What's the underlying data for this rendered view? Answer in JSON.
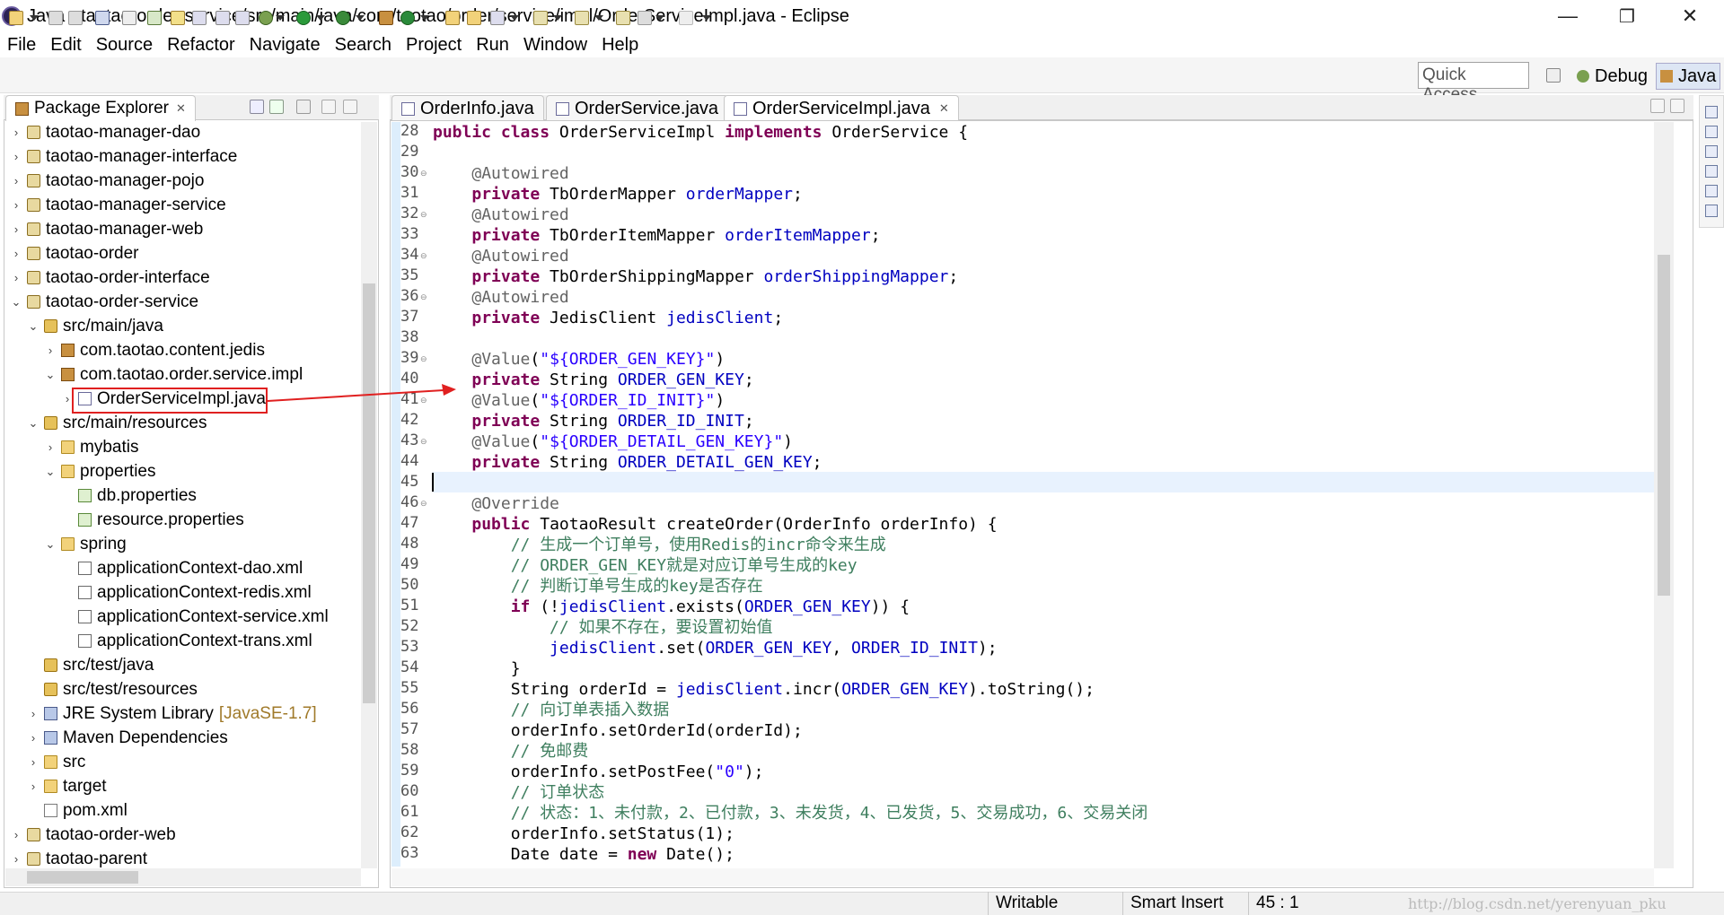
{
  "window": {
    "title": "Java - taotao-order-service/src/main/java/com/taotao/order/service/impl/OrderServiceImpl.java - Eclipse",
    "minimize": "—",
    "maximize": "❐",
    "close": "✕"
  },
  "menu": [
    "File",
    "Edit",
    "Source",
    "Refactor",
    "Navigate",
    "Search",
    "Project",
    "Run",
    "Window",
    "Help"
  ],
  "toolbar": {
    "quick_access": "Quick Access",
    "debug": "Debug",
    "java": "Java"
  },
  "explorer": {
    "title": "Package Explorer",
    "close_glyph": "✕",
    "items": [
      {
        "label": "taotao-manager-dao",
        "twisty": "›",
        "icon": "proj"
      },
      {
        "label": "taotao-manager-interface",
        "twisty": "›",
        "icon": "proj"
      },
      {
        "label": "taotao-manager-pojo",
        "twisty": "›",
        "icon": "proj"
      },
      {
        "label": "taotao-manager-service",
        "twisty": "›",
        "icon": "proj"
      },
      {
        "label": "taotao-manager-web",
        "twisty": "›",
        "icon": "proj"
      },
      {
        "label": "taotao-order",
        "twisty": "›",
        "icon": "proj"
      },
      {
        "label": "taotao-order-interface",
        "twisty": "›",
        "icon": "proj"
      },
      {
        "label": "taotao-order-service",
        "twisty": "⌄",
        "icon": "proj"
      },
      {
        "label": "src/main/java",
        "twisty": "⌄",
        "icon": "pkgf"
      },
      {
        "label": "com.taotao.content.jedis",
        "twisty": "›",
        "icon": "pkg"
      },
      {
        "label": "com.taotao.order.service.impl",
        "twisty": "⌄",
        "icon": "pkg"
      },
      {
        "label": "OrderServiceImpl.java",
        "twisty": "›",
        "icon": "java"
      },
      {
        "label": "src/main/resources",
        "twisty": "⌄",
        "icon": "pkgf"
      },
      {
        "label": "mybatis",
        "twisty": "›",
        "icon": "folder"
      },
      {
        "label": "properties",
        "twisty": "⌄",
        "icon": "folder"
      },
      {
        "label": "db.properties",
        "twisty": "",
        "icon": "props"
      },
      {
        "label": "resource.properties",
        "twisty": "",
        "icon": "props"
      },
      {
        "label": "spring",
        "twisty": "⌄",
        "icon": "folder"
      },
      {
        "label": "applicationContext-dao.xml",
        "twisty": "",
        "icon": "xml"
      },
      {
        "label": "applicationContext-redis.xml",
        "twisty": "",
        "icon": "xml"
      },
      {
        "label": "applicationContext-service.xml",
        "twisty": "",
        "icon": "xml"
      },
      {
        "label": "applicationContext-trans.xml",
        "twisty": "",
        "icon": "xml"
      },
      {
        "label": "src/test/java",
        "twisty": "",
        "icon": "pkgf"
      },
      {
        "label": "src/test/resources",
        "twisty": "",
        "icon": "pkgf"
      },
      {
        "label": "JRE System Library",
        "suffix": "[JavaSE-1.7]",
        "twisty": "›",
        "icon": "lib"
      },
      {
        "label": "Maven Dependencies",
        "twisty": "›",
        "icon": "lib"
      },
      {
        "label": "src",
        "twisty": "›",
        "icon": "folder"
      },
      {
        "label": "target",
        "twisty": "›",
        "icon": "folder"
      },
      {
        "label": "pom.xml",
        "twisty": "",
        "icon": "pom"
      },
      {
        "label": "taotao-order-web",
        "twisty": "›",
        "icon": "proj"
      },
      {
        "label": "taotao-parent",
        "twisty": "›",
        "icon": "proj"
      }
    ]
  },
  "editor": {
    "tabs": [
      {
        "label": "OrderInfo.java",
        "active": false
      },
      {
        "label": "OrderService.java",
        "active": false
      },
      {
        "label": "OrderServiceImpl.java",
        "active": true
      }
    ],
    "lines": [
      {
        "n": "28",
        "fold": "",
        "html": "<span class='kw'>public class</span> OrderServiceImpl <span class='kw'>implements</span> OrderService {"
      },
      {
        "n": "29",
        "fold": "",
        "html": ""
      },
      {
        "n": "30",
        "fold": "⊖",
        "html": "    <span class='ann'>@Autowired</span>"
      },
      {
        "n": "31",
        "fold": "",
        "html": "    <span class='kw'>private</span> TbOrderMapper <span class='fld'>orderMapper</span>;"
      },
      {
        "n": "32",
        "fold": "⊖",
        "html": "    <span class='ann'>@Autowired</span>"
      },
      {
        "n": "33",
        "fold": "",
        "html": "    <span class='kw'>private</span> TbOrderItemMapper <span class='fld'>orderItemMapper</span>;"
      },
      {
        "n": "34",
        "fold": "⊖",
        "html": "    <span class='ann'>@Autowired</span>"
      },
      {
        "n": "35",
        "fold": "",
        "html": "    <span class='kw'>private</span> TbOrderShippingMapper <span class='fld'>orderShippingMapper</span>;"
      },
      {
        "n": "36",
        "fold": "⊖",
        "html": "    <span class='ann'>@Autowired</span>"
      },
      {
        "n": "37",
        "fold": "",
        "html": "    <span class='kw'>private</span> JedisClient <span class='fld'>jedisClient</span>;"
      },
      {
        "n": "38",
        "fold": "",
        "html": ""
      },
      {
        "n": "39",
        "fold": "⊖",
        "html": "    <span class='ann'>@Value</span>(<span class='str'>\"${ORDER_GEN_KEY}\"</span>)"
      },
      {
        "n": "40",
        "fold": "",
        "html": "    <span class='kw'>private</span> String <span class='fld'>ORDER_GEN_KEY</span>;"
      },
      {
        "n": "41",
        "fold": "⊖",
        "html": "    <span class='ann'>@Value</span>(<span class='str'>\"${ORDER_ID_INIT}\"</span>)"
      },
      {
        "n": "42",
        "fold": "",
        "html": "    <span class='kw'>private</span> String <span class='fld'>ORDER_ID_INIT</span>;"
      },
      {
        "n": "43",
        "fold": "⊖",
        "html": "    <span class='ann'>@Value</span>(<span class='str'>\"${ORDER_DETAIL_GEN_KEY}\"</span>)"
      },
      {
        "n": "44",
        "fold": "",
        "html": "    <span class='kw'>private</span> String <span class='fld'>ORDER_DETAIL_GEN_KEY</span>;"
      },
      {
        "n": "45",
        "fold": "",
        "html": ""
      },
      {
        "n": "46",
        "fold": "⊖",
        "html": "    <span class='ann'>@Override</span>"
      },
      {
        "n": "47",
        "fold": "",
        "html": "    <span class='kw'>public</span> TaotaoResult createOrder(OrderInfo orderInfo) {"
      },
      {
        "n": "48",
        "fold": "",
        "html": "        <span class='cmt'>// 生成一个订单号，使用Redis的incr命令来生成</span>"
      },
      {
        "n": "49",
        "fold": "",
        "html": "        <span class='cmt'>// ORDER_GEN_KEY就是对应订单号生成的key</span>"
      },
      {
        "n": "50",
        "fold": "",
        "html": "        <span class='cmt'>// 判断订单号生成的key是否存在</span>"
      },
      {
        "n": "51",
        "fold": "",
        "html": "        <span class='kw'>if</span> (!<span class='fld'>jedisClient</span>.exists(<span class='fld'>ORDER_GEN_KEY</span>)) {"
      },
      {
        "n": "52",
        "fold": "",
        "html": "            <span class='cmt'>// 如果不存在，要设置初始值</span>"
      },
      {
        "n": "53",
        "fold": "",
        "html": "            <span class='fld'>jedisClient</span>.set(<span class='fld'>ORDER_GEN_KEY</span>, <span class='fld'>ORDER_ID_INIT</span>);"
      },
      {
        "n": "54",
        "fold": "",
        "html": "        }"
      },
      {
        "n": "55",
        "fold": "",
        "html": "        String orderId = <span class='fld'>jedisClient</span>.incr(<span class='fld'>ORDER_GEN_KEY</span>).toString();"
      },
      {
        "n": "56",
        "fold": "",
        "html": "        <span class='cmt'>// 向订单表插入数据</span>"
      },
      {
        "n": "57",
        "fold": "",
        "html": "        orderInfo.setOrderId(orderId);"
      },
      {
        "n": "58",
        "fold": "",
        "html": "        <span class='cmt'>// 免邮费</span>"
      },
      {
        "n": "59",
        "fold": "",
        "html": "        orderInfo.setPostFee(<span class='str'>\"0\"</span>);"
      },
      {
        "n": "60",
        "fold": "",
        "html": "        <span class='cmt'>// 订单状态</span>"
      },
      {
        "n": "61",
        "fold": "",
        "html": "        <span class='cmt'>// 状态：1、未付款，2、已付款，3、未发货，4、已发货，5、交易成功，6、交易关闭</span>"
      },
      {
        "n": "62",
        "fold": "",
        "html": "        orderInfo.setStatus(1);"
      },
      {
        "n": "63",
        "fold": "",
        "html": "        Date date = <span class='kw'>new</span> Date();"
      }
    ]
  },
  "status": {
    "writable": "Writable",
    "insert_mode": "Smart Insert",
    "position": "45 : 1",
    "watermark": "http://blog.csdn.net/yerenyuan_pku"
  }
}
